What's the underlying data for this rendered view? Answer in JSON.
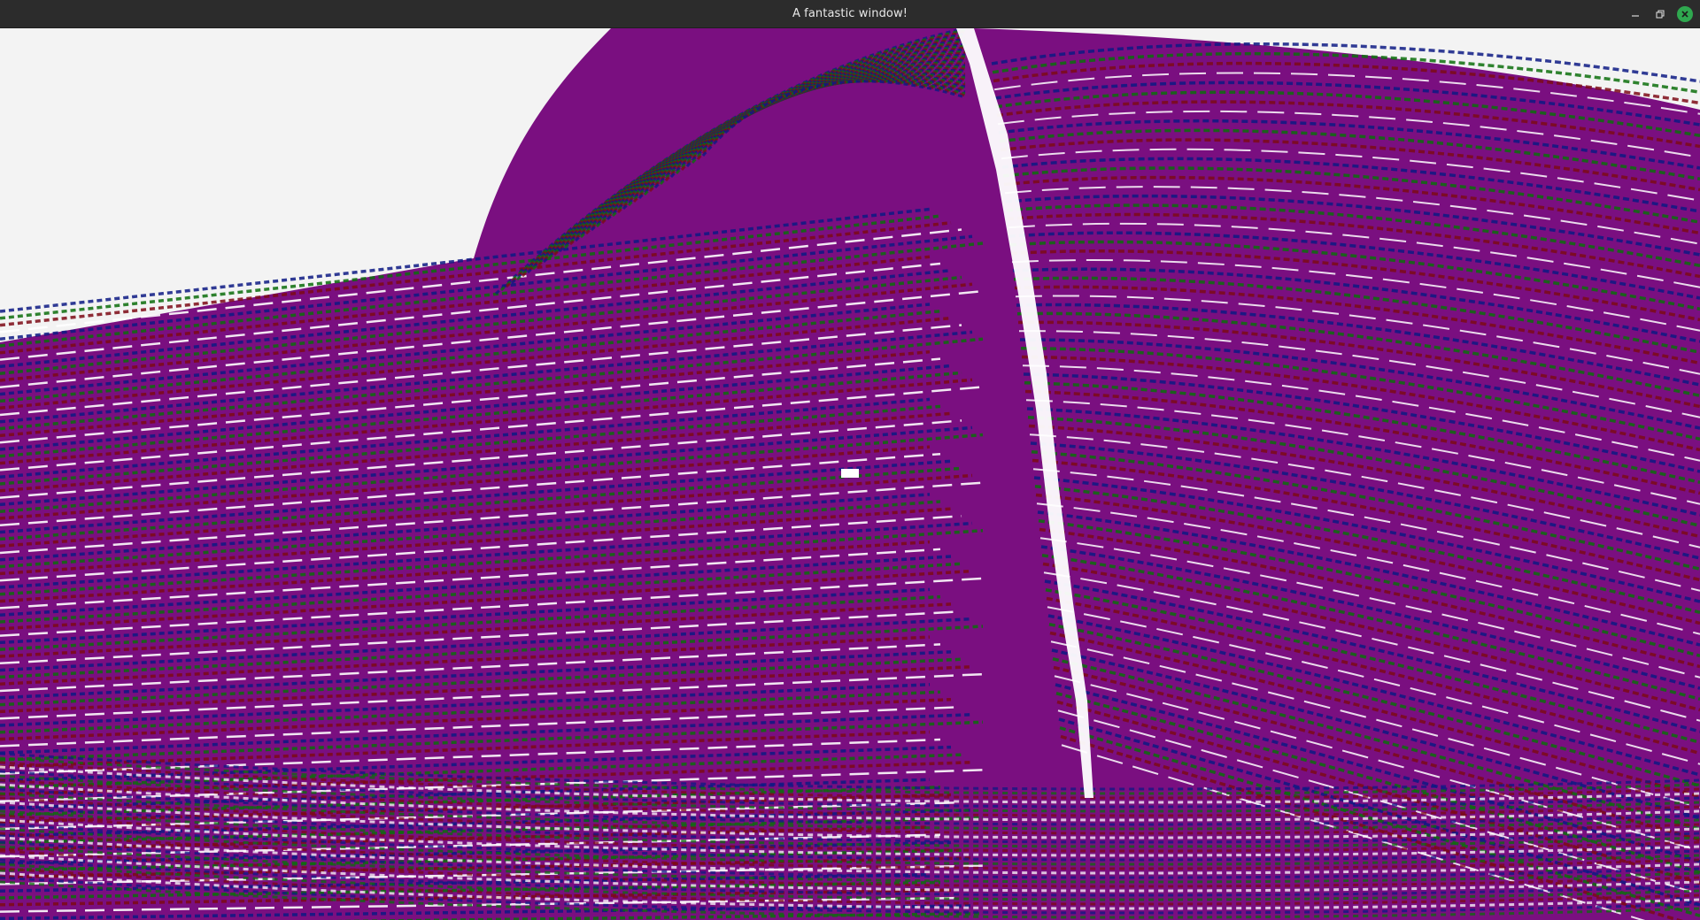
{
  "window": {
    "title": "A fantastic window!",
    "controls": {
      "minimize_icon": "minimize-icon",
      "maximize_icon": "restore-icon",
      "close_icon": "close-icon"
    }
  },
  "scene": {
    "background": "#f3f3f3",
    "palette": {
      "purple": "#7a0f80",
      "navy": "#0d1a84",
      "green": "#0c6e0c",
      "maroon": "#7d0a16",
      "white": "#ffffff"
    }
  }
}
